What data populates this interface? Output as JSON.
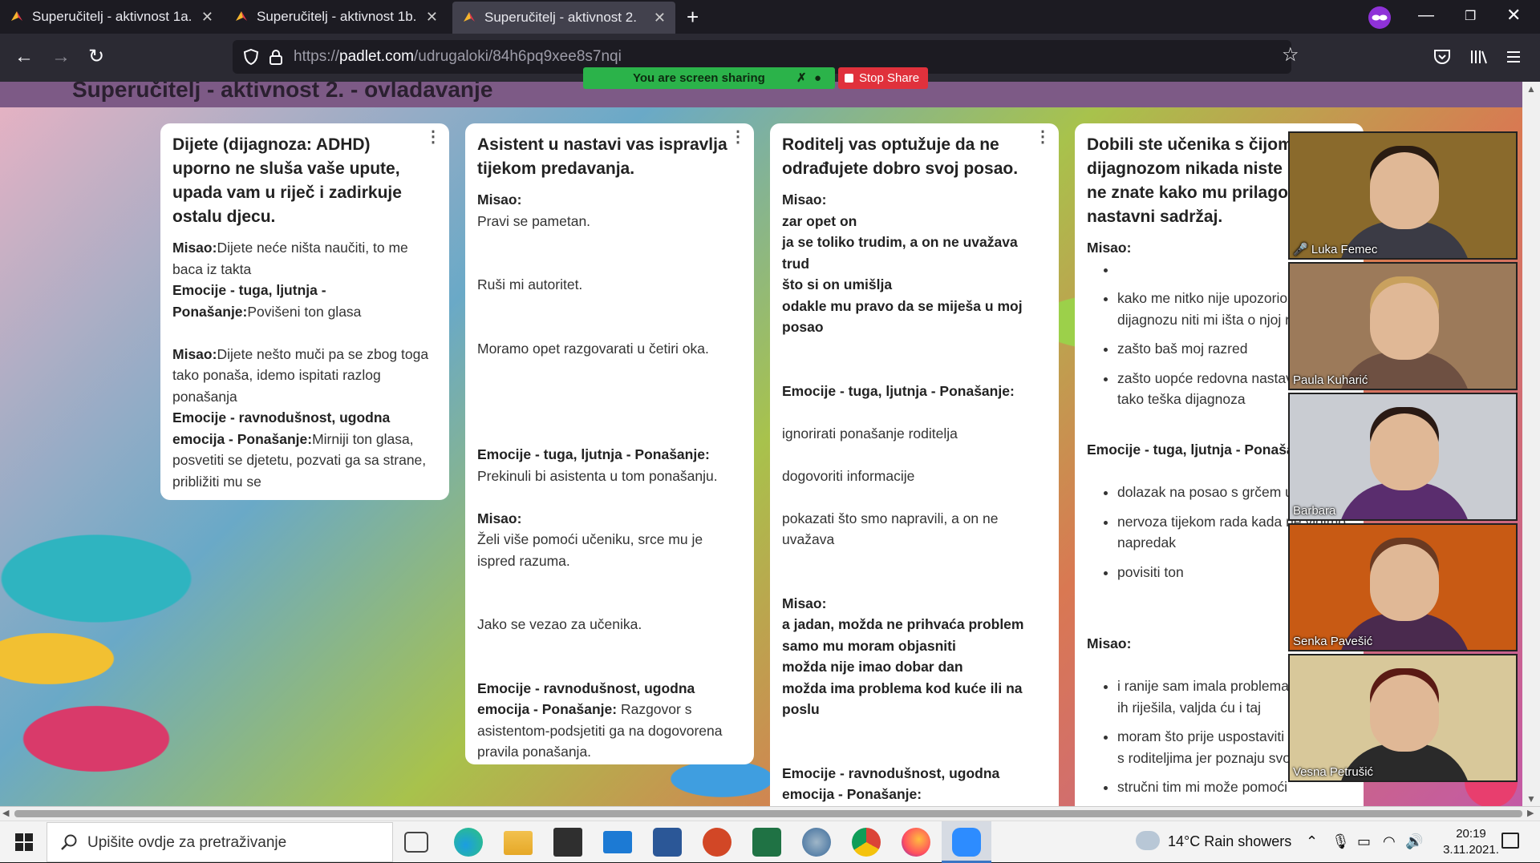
{
  "browser": {
    "tabs": [
      {
        "title": "Superučitelj - aktivnost 1a.",
        "active": false
      },
      {
        "title": "Superučitelj - aktivnost 1b.",
        "active": false
      },
      {
        "title": "Superučitelj - aktivnost 2.",
        "active": true
      }
    ],
    "new_tab": "+",
    "url_prefix": "https://",
    "url_domain": "padlet.com",
    "url_path": "/udrugaloki/84h6pq9xee8s7nqi"
  },
  "page": {
    "title": "Superučitelj - aktivnost 2. - ovladavanje"
  },
  "screen_share": {
    "status": "You are screen sharing",
    "stop": "Stop Share"
  },
  "cards": [
    {
      "title": "Dijete (dijagnoza: ADHD) uporno ne sluša vaše upute, upada vam u riječ i zadirkuje ostalu djecu.",
      "lines": [
        [
          {
            "t": "Misao:",
            "b": true
          },
          {
            "t": "Dijete neće ništa naučiti, to me baca iz takta",
            "b": false
          }
        ],
        [
          {
            "t": "Emocije - tuga, ljutnja - Ponašanje:",
            "b": true
          },
          {
            "t": "Povišeni ton glasa",
            "b": false
          }
        ],
        [],
        [
          {
            "t": "Misao:",
            "b": true
          },
          {
            "t": "Dijete nešto muči pa se zbog toga tako ponaša, idemo ispitati razlog ponašanja",
            "b": false
          }
        ],
        [
          {
            "t": "Emocije - ravnodušnost, ugodna emocija - Ponašanje:",
            "b": true
          },
          {
            "t": "Mirniji ton glasa, posvetiti se djetetu, pozvati ga sa strane, približiti mu se",
            "b": false
          }
        ]
      ]
    },
    {
      "title": "Asistent u nastavi vas ispravlja tijekom predavanja.",
      "lines": [
        [
          {
            "t": "Misao:",
            "b": true
          }
        ],
        [
          {
            "t": "Pravi se pametan.",
            "b": false
          }
        ],
        [],
        [],
        [
          {
            "t": "Ruši mi autoritet.",
            "b": false
          }
        ],
        [],
        [],
        [
          {
            "t": "Moramo opet razgovarati u četiri oka.",
            "b": false
          }
        ],
        [],
        [],
        [],
        [],
        [
          {
            "t": "Emocije - tuga, ljutnja - Ponašanje:",
            "b": true
          }
        ],
        [
          {
            "t": "Prekinuli bi asistenta u tom ponašanju.",
            "b": false
          }
        ],
        [],
        [
          {
            "t": "Misao:",
            "b": true
          }
        ],
        [
          {
            "t": "Želi više pomoći učeniku, srce mu je ispred razuma.",
            "b": false
          }
        ],
        [],
        [],
        [
          {
            "t": "Jako se vezao za učenika.",
            "b": false
          }
        ],
        [],
        [],
        [
          {
            "t": "Emocije - ravnodušnost, ugodna emocija - Ponašanje:",
            "b": true
          },
          {
            "t": " Razgovor s asistentom-podsjetiti ga na dogovorena pravila ponašanja.",
            "b": false
          }
        ]
      ]
    },
    {
      "title": "Roditelj vas optužuje da ne odrađujete dobro svoj posao.",
      "lines": [
        [
          {
            "t": "Misao:",
            "b": true
          }
        ],
        [
          {
            "t": "zar opet on",
            "b": true
          }
        ],
        [
          {
            "t": "ja se toliko trudim, a on ne uvažava trud",
            "b": true
          }
        ],
        [
          {
            "t": "što si on umišlja",
            "b": true
          }
        ],
        [
          {
            "t": "odakle mu pravo da se miješa u moj posao",
            "b": true
          }
        ],
        [],
        [],
        [
          {
            "t": "Emocije - tuga, ljutnja - Ponašanje:",
            "b": true
          }
        ],
        [],
        [
          {
            "t": "ignorirati ponašanje roditelja",
            "b": false
          }
        ],
        [],
        [
          {
            "t": "dogovoriti informacije",
            "b": false
          }
        ],
        [],
        [
          {
            "t": "pokazati što smo napravili, a on ne uvažava",
            "b": false
          }
        ],
        [],
        [],
        [
          {
            "t": "Misao:",
            "b": true
          }
        ],
        [
          {
            "t": "a jadan, možda ne prihvaća problem samo mu moram objasniti",
            "b": true
          }
        ],
        [
          {
            "t": "možda nije imao dobar dan",
            "b": true
          }
        ],
        [
          {
            "t": "možda ima problema kod kuće ili na poslu",
            "b": true
          }
        ],
        [],
        [],
        [
          {
            "t": "Emocije - ravnodušnost, ugodna emocija - Ponašanje:",
            "b": true
          }
        ]
      ]
    },
    {
      "title": "Dobili ste učenika s čijom dijagnozom nikada niste radili i ne znate kako mu prilagoditi nastavni sadržaj.",
      "misao1": "Misao:",
      "bullets1": [
        "",
        "kako me nitko nije upozorio na ovu dijagnozu niti mi išta o njoj rekao",
        "zašto baš moj razred",
        "zašto uopće redovna nastava kad je tako teška dijagnoza"
      ],
      "emocije": "Emocije - tuga, ljutnja - Ponašanje:",
      "bullets2": [
        "dolazak na posao s grčem u želucu",
        "nervoza tijekom rada kada ne vidimo napredak",
        "povisiti ton"
      ],
      "misao2": "Misao:",
      "bullets3": [
        "i ranije sam imala problema pa sam ih riješila, valjda ću i taj",
        "moram što prije uspostaviti suradnju s roditeljima jer poznaju svoje dijete",
        "stručni tim mi može pomoći"
      ]
    }
  ],
  "participants": [
    {
      "name": "Luka Femec",
      "muted": true,
      "bg": "#8a6a2c",
      "shirt": "#3b3b45",
      "hair": "#2a1c12"
    },
    {
      "name": "Paula Kuharić",
      "muted": false,
      "bg": "#9c7a5a",
      "shirt": "#6e5042",
      "hair": "#c9a15e"
    },
    {
      "name": "Barbara",
      "muted": false,
      "bg": "#c9ccd2",
      "shirt": "#5a2d6e",
      "hair": "#2a1a14"
    },
    {
      "name": "Senka Pavešić",
      "muted": false,
      "bg": "#c85a14",
      "shirt": "#4a2a4e",
      "hair": "#6a3a22"
    },
    {
      "name": "Vesna Petrušić",
      "muted": false,
      "bg": "#d8c89a",
      "shirt": "#2a2a2a",
      "hair": "#5a1a14"
    }
  ],
  "taskbar": {
    "search_placeholder": "Upišite ovdje za pretraživanje",
    "weather": "14°C  Rain showers",
    "time": "20:19",
    "date": "3.11.2021."
  },
  "icons": [
    "firefox-icon",
    "lock-icon",
    "shield-icon",
    "star-icon",
    "windows-start-icon",
    "search-icon",
    "task-view-icon",
    "edge-icon",
    "file-explorer-icon",
    "store-icon",
    "mail-icon",
    "word-icon",
    "powerpoint-icon",
    "excel-icon",
    "chrome-icon",
    "zoom-icon",
    "notifications-icon"
  ],
  "colors": {
    "share_green": "#2bb34a",
    "stop_red": "#e0313c",
    "tab_bg": "#1c1b22"
  }
}
